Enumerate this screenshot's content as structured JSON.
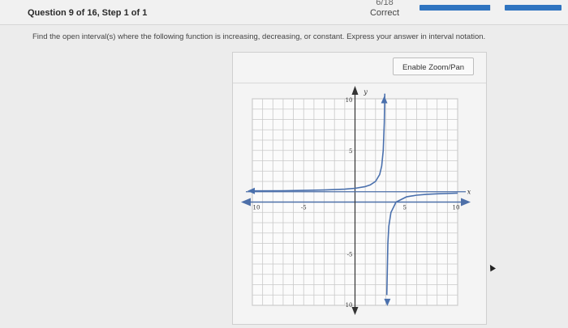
{
  "header": {
    "question_label": "Question 9 of 16, Step 1 of 1",
    "score_fraction": "6/18",
    "score_status": "Correct",
    "progress_fraction": 0.99
  },
  "prompt": {
    "instruction": "Find the open interval(s) where the following function is increasing, decreasing, or constant. Express your answer in interval notation."
  },
  "graph_panel": {
    "zoom_button_label": "Enable Zoom/Pan",
    "axis_x_label": "x",
    "axis_y_label": "y",
    "tick_labels": {
      "x_neg10": "10",
      "x_neg5": "-5",
      "x_5": "5",
      "x_10": "10",
      "y_10": "10",
      "y_5": "5",
      "y_neg5": "-5",
      "y_neg10": "10"
    }
  },
  "chart_data": {
    "type": "line",
    "title": "",
    "xlabel": "x",
    "ylabel": "y",
    "xlim": [
      -10,
      10
    ],
    "ylim": [
      -10,
      10
    ],
    "grid": true,
    "vertical_asymptote": 3,
    "horizontal_asymptote": 1,
    "series": [
      {
        "x": [
          -10,
          -7,
          -5,
          -3,
          -1,
          0,
          1,
          1.5,
          2,
          2.4,
          2.6,
          2.75,
          2.85,
          2.9
        ],
        "y": [
          1.08,
          1.1,
          1.13,
          1.17,
          1.25,
          1.33,
          1.5,
          1.67,
          2.0,
          2.67,
          3.5,
          5.0,
          7.67,
          11.0
        ]
      },
      {
        "x": [
          3.1,
          3.2,
          3.3,
          3.5,
          4,
          5,
          6,
          7,
          8,
          10
        ],
        "y": [
          -9.0,
          -4.0,
          -2.33,
          -1.0,
          0.0,
          0.5,
          0.67,
          0.75,
          0.8,
          0.86
        ]
      }
    ]
  }
}
